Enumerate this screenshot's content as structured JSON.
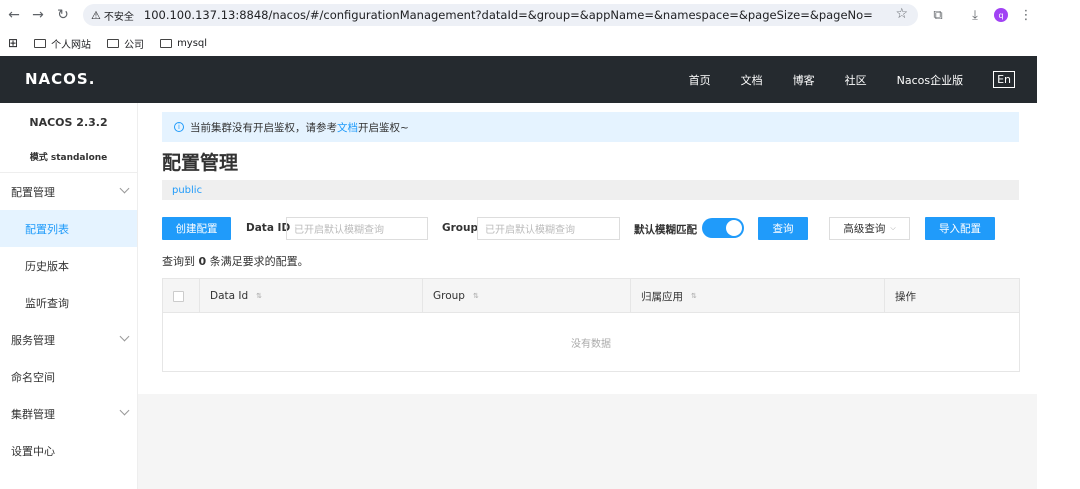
{
  "browser": {
    "security_label": "不安全",
    "url": "100.100.137.13:8848/nacos/#/configurationManagement?dataId=&group=&appName=&namespace=&pageSize=&pageNo=",
    "avatar_letter": "q",
    "bookmarks": [
      "个人网站",
      "公司",
      "mysql"
    ]
  },
  "header": {
    "logo": "NACOS.",
    "nav": [
      "首页",
      "文档",
      "博客",
      "社区",
      "Nacos企业版"
    ],
    "lang": "En"
  },
  "sidebar": {
    "title": "NACOS 2.3.2",
    "mode": "模式 standalone",
    "items": [
      {
        "label": "配置管理"
      },
      {
        "label": "配置列表"
      },
      {
        "label": "历史版本"
      },
      {
        "label": "监听查询"
      },
      {
        "label": "服务管理"
      },
      {
        "label": "命名空间"
      },
      {
        "label": "集群管理"
      },
      {
        "label": "设置中心"
      }
    ]
  },
  "notice": {
    "prefix": "当前集群没有开启鉴权，请参考",
    "link": "文档",
    "suffix": "开启鉴权~"
  },
  "page": {
    "title": "配置管理",
    "namespace": "public"
  },
  "toolbar": {
    "create_label": "创建配置",
    "dataid_label": "Data ID",
    "dataid_placeholder": "已开启默认模糊查询",
    "group_label": "Group",
    "group_placeholder": "已开启默认模糊查询",
    "fuzzy_label": "默认模糊匹配",
    "query_label": "查询",
    "advanced_label": "高级查询",
    "import_label": "导入配置"
  },
  "result": {
    "prefix": "查询到",
    "count": "0",
    "suffix": "条满足要求的配置。"
  },
  "table": {
    "columns": [
      "Data Id",
      "Group",
      "归属应用",
      "操作"
    ],
    "empty_text": "没有数据"
  },
  "colors": {
    "primary": "#209bfa",
    "header_bg": "#252a2f"
  }
}
